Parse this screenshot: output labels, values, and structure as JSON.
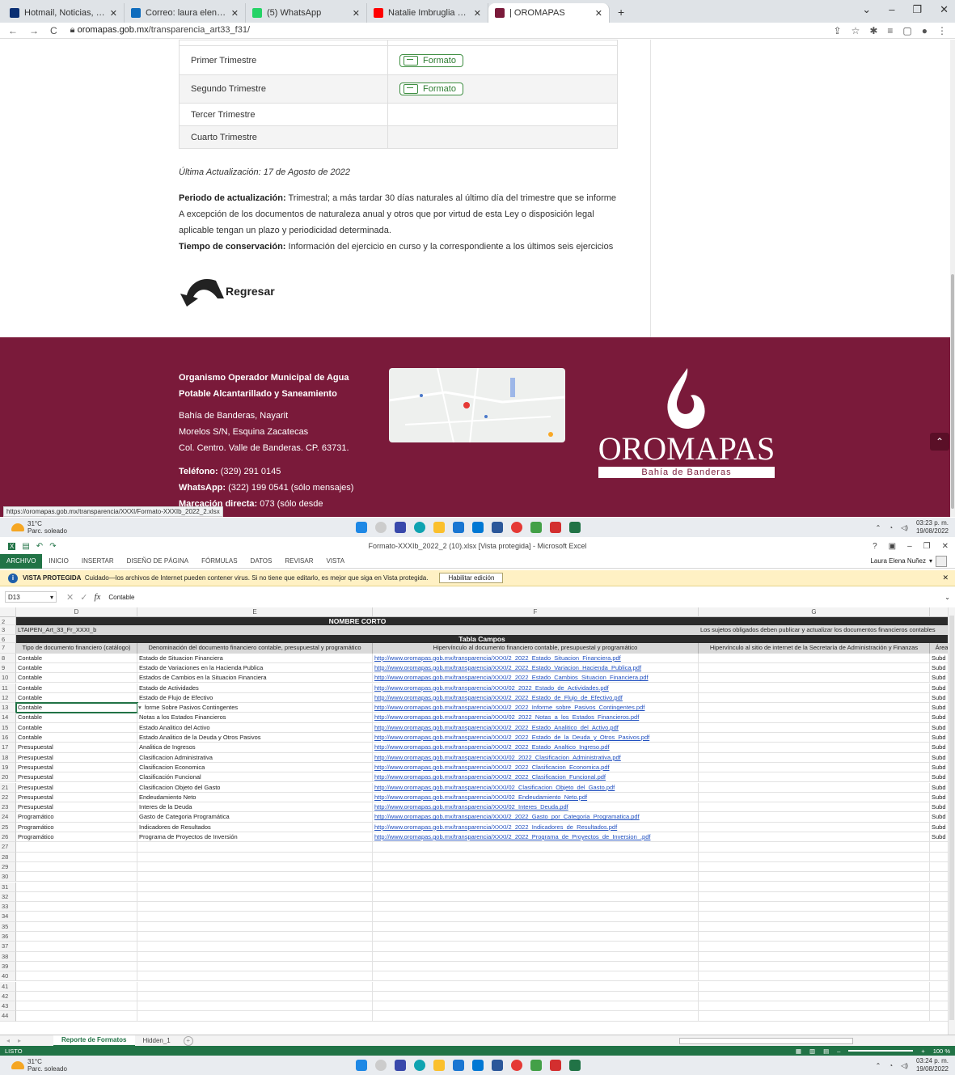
{
  "browser": {
    "tabs": [
      {
        "label": "Hotmail, Noticias, Deportes y Ent",
        "color": "#0a2f73"
      },
      {
        "label": "Correo: laura elena nuñez parra -",
        "color": "#0f6cbd"
      },
      {
        "label": "(5) WhatsApp",
        "color": "#25d366"
      },
      {
        "label": "Natalie Imbruglia - Torn (Live)",
        "color": "#ff0000"
      },
      {
        "label": "| OROMAPAS",
        "color": "#7a1a3a"
      }
    ],
    "new_tab": "+",
    "url_domain": "oromapas.gob.mx",
    "url_path": "/transparencia_art33_f31/"
  },
  "page": {
    "trimestres": [
      {
        "label": "Primer Trimestre",
        "button": "Formato"
      },
      {
        "label": "Segundo Trimestre",
        "button": "Formato"
      },
      {
        "label": "Tercer Trimestre",
        "button": ""
      },
      {
        "label": "Cuarto Trimestre",
        "button": ""
      }
    ],
    "last_update": "Última Actualización:  17 de Agosto de 2022",
    "period_label": "Periodo de actualización:",
    "period_text": " Trimestral; a más tardar 30 días naturales al último día del trimestre que se informe",
    "exception_text": "A excepción de los documentos de naturaleza anual y otros que por virtud de esta Ley o disposición legal aplicable tengan un plazo y periodicidad determinada.",
    "conservation_label": "Tiempo de conservación:",
    "conservation_text": " Información del ejercicio en curso y la correspondiente a los últimos seis ejercicios",
    "back_label": "Regresar"
  },
  "footer": {
    "org_line1": "Organismo Operador Municipal de Agua",
    "org_line2": "Potable Alcantarillado y Saneamiento",
    "addr_line1": "Bahía de Banderas, Nayarit",
    "addr_line2": "Morelos S/N, Esquina Zacatecas",
    "addr_line3": "Col. Centro. Valle de Banderas. CP. 63731.",
    "phone_label": "Teléfono:",
    "phone": " (329) 291 0145",
    "whatsapp_label": "WhatsApp:",
    "whatsapp": " (322) 199 0541 (sólo mensajes)",
    "direct_label": "Marcación directa:",
    "direct": " 073 (sólo desde",
    "logo_name": "OROMAPAS",
    "logo_sub": "Bahía de Banderas",
    "status_url": "https://oromapas.gob.mx/transparencia/XXXI/Formato-XXXIb_2022_2.xlsx"
  },
  "taskbar1": {
    "weather_temp": "31°C",
    "weather_desc": "Parc. soleado",
    "time": "03:23 p. m.",
    "date": "19/08/2022"
  },
  "taskbar2": {
    "weather_temp": "31°C",
    "weather_desc": "Parc. soleado",
    "time": "03:24 p. m.",
    "date": "19/08/2022"
  },
  "excel": {
    "title": "Formato-XXXIb_2022_2 (10).xlsx  [Vista protegida] - Microsoft Excel",
    "ribbon_tabs": [
      "ARCHIVO",
      "INICIO",
      "INSERTAR",
      "DISEÑO DE PÁGINA",
      "FÓRMULAS",
      "DATOS",
      "REVISAR",
      "VISTA"
    ],
    "user": "Laura Elena Nuñez",
    "pv_label": "VISTA PROTEGIDA",
    "pv_text": "Cuidado—los archivos de Internet pueden contener virus. Si no tiene que editarlo, es mejor que siga en Vista protegida.",
    "pv_button": "Habilitar edición",
    "name_box": "D13",
    "formula_value": "Contable",
    "columns": [
      "D",
      "E",
      "F",
      "G"
    ],
    "nombre_corto": "NOMBRE CORTO",
    "row3_d": "LTAIPEN_Art_33_Fr_XXXI_b",
    "row3_g": "Los sujetos obligados deben publicar y actualizar los documentos financieros contables",
    "tabla_campos": "Tabla Campos",
    "headers": [
      "Tipo de documento financiero (catálogo)",
      "Denominación del documento financiero contable, presupuestal y programático",
      "Hipervínculo al documento financiero contable, presupuestal y programático",
      "Hipervínculo al sitio de internet de la Secretaría de Administración y Finanzas",
      "Área"
    ],
    "rows": [
      [
        "8",
        "Contable",
        "Estado de Situacion Financiera",
        "http://www.oromapas.gob.mx/transparencia/XXXI/2_2022_Estado_Situacion_Financiera.pdf",
        "Subd"
      ],
      [
        "9",
        "Contable",
        "Estado de Variaciones en la Hacienda Publica",
        "http://www.oromapas.gob.mx/transparencia/XXXI/2_2022_Estado_Variacion_Hacienda_Publica.pdf",
        "Subd"
      ],
      [
        "10",
        "Contable",
        "Estados de Cambios en la Situacion Financiera",
        "http://www.oromapas.gob.mx/transparencia/XXXI/2_2022_Estado_Cambios_Situacion_Financiera.pdf",
        "Subd"
      ],
      [
        "11",
        "Contable",
        "Estado de Actividades",
        "http://www.oromapas.gob.mx/transparencia/XXXI/02_2022_Estado_de_Actividades.pdf",
        "Subd"
      ],
      [
        "12",
        "Contable",
        "Estado de Flujo de Efectivo",
        "http://www.oromapas.gob.mx/transparencia/XXXI/2_2022_Estado_de_Flujo_de_Efectivo.pdf",
        "Subd"
      ],
      [
        "13",
        "Contable",
        "Informe Sobre Pasivos Contingentes",
        "http://www.oromapas.gob.mx/transparencia/XXXI/2_2022_Informe_sobre_Pasivos_Contingentes.pdf",
        "Subd"
      ],
      [
        "14",
        "Contable",
        "Notas a los Estados Financieros",
        "http://www.oromapas.gob.mx/transparencia/XXXI/02_2022_Notas_a_los_Estados_Financieros.pdf",
        "Subd"
      ],
      [
        "15",
        "Contable",
        "Estado Analitico del Activo",
        "http://www.oromapas.gob.mx/transparencia/XXXI/2_2022_Estado_Analitico_del_Activo.pdf",
        "Subd"
      ],
      [
        "16",
        "Contable",
        "Estado Analitico de la Deuda y Otros Pasivos",
        "http://www.oromapas.gob.mx/transparencia/XXXI/2_2022_Estado_de_la_Deuda_y_Otros_Pasivos.pdf",
        "Subd"
      ],
      [
        "17",
        "Presupuestal",
        "Analitica de Ingresos",
        "http://www.oromapas.gob.mx/transparencia/XXXI/2_2022_Estado_Analtico_Ingreso.pdf",
        "Subd"
      ],
      [
        "18",
        "Presupuestal",
        "Clasificacion Administrativa",
        "http://www.oromapas.gob.mx/transparencia/XXXI/02_2022_Clasificacion_Administrativa.pdf",
        "Subd"
      ],
      [
        "19",
        "Presupuestal",
        "Clasificacion Economica",
        "http://www.oromapas.gob.mx/transparencia/XXXI/2_2022_Clasificacion_Economica.pdf",
        "Subd"
      ],
      [
        "20",
        "Presupuestal",
        "Clasificación Funcional",
        "http://www.oromapas.gob.mx/transparencia/XXXI/2_2022_Clasificacion_Funcional.pdf",
        "Subd"
      ],
      [
        "21",
        "Presupuestal",
        "Clasificacion Objeto del Gasto",
        "http://www.oromapas.gob.mx/transparencia/XXXI/02_Clasificacion_Objeto_del_Gasto.pdf",
        "Subd"
      ],
      [
        "22",
        "Presupuestal",
        "Endeudamiento Neto",
        "http://www.oromapas.gob.mx/transparencia/XXXI/02_Endeudamiento_Neto.pdf",
        "Subd"
      ],
      [
        "23",
        "Presupuestal",
        "Interes de la Deuda",
        "http://www.oromapas.gob.mx/transparencia/XXXI/02_Interes_Deuda.pdf",
        "Subd"
      ],
      [
        "24",
        "Programático",
        "Gasto de Categoria Programática",
        "http://www.oromapas.gob.mx/transparencia/XXXI/2_2022_Gasto_por_Categoria_Programatica.pdf",
        "Subd"
      ],
      [
        "25",
        "Programático",
        "Indicadores de Resultados",
        "http://www.oromapas.gob.mx/transparencia/XXXI/2_2022_Indicadores_de_Resultados.pdf",
        "Subd"
      ],
      [
        "26",
        "Programático",
        "Programa de Proyectos de Inversión",
        "http://www.oromapas.gob.mx/transparencia/XXXI/2_2022_Programa_de_Proyectos_de_Inversion_.pdf",
        "Subd"
      ]
    ],
    "empty_rows": [
      "27",
      "28",
      "29",
      "30",
      "31",
      "32",
      "33",
      "34",
      "35",
      "36",
      "37",
      "38",
      "39",
      "40",
      "41",
      "42",
      "43",
      "44"
    ],
    "sheet_tabs": [
      "Reporte de Formatos",
      "Hidden_1"
    ],
    "status": "LISTO",
    "zoom": "100 %"
  }
}
